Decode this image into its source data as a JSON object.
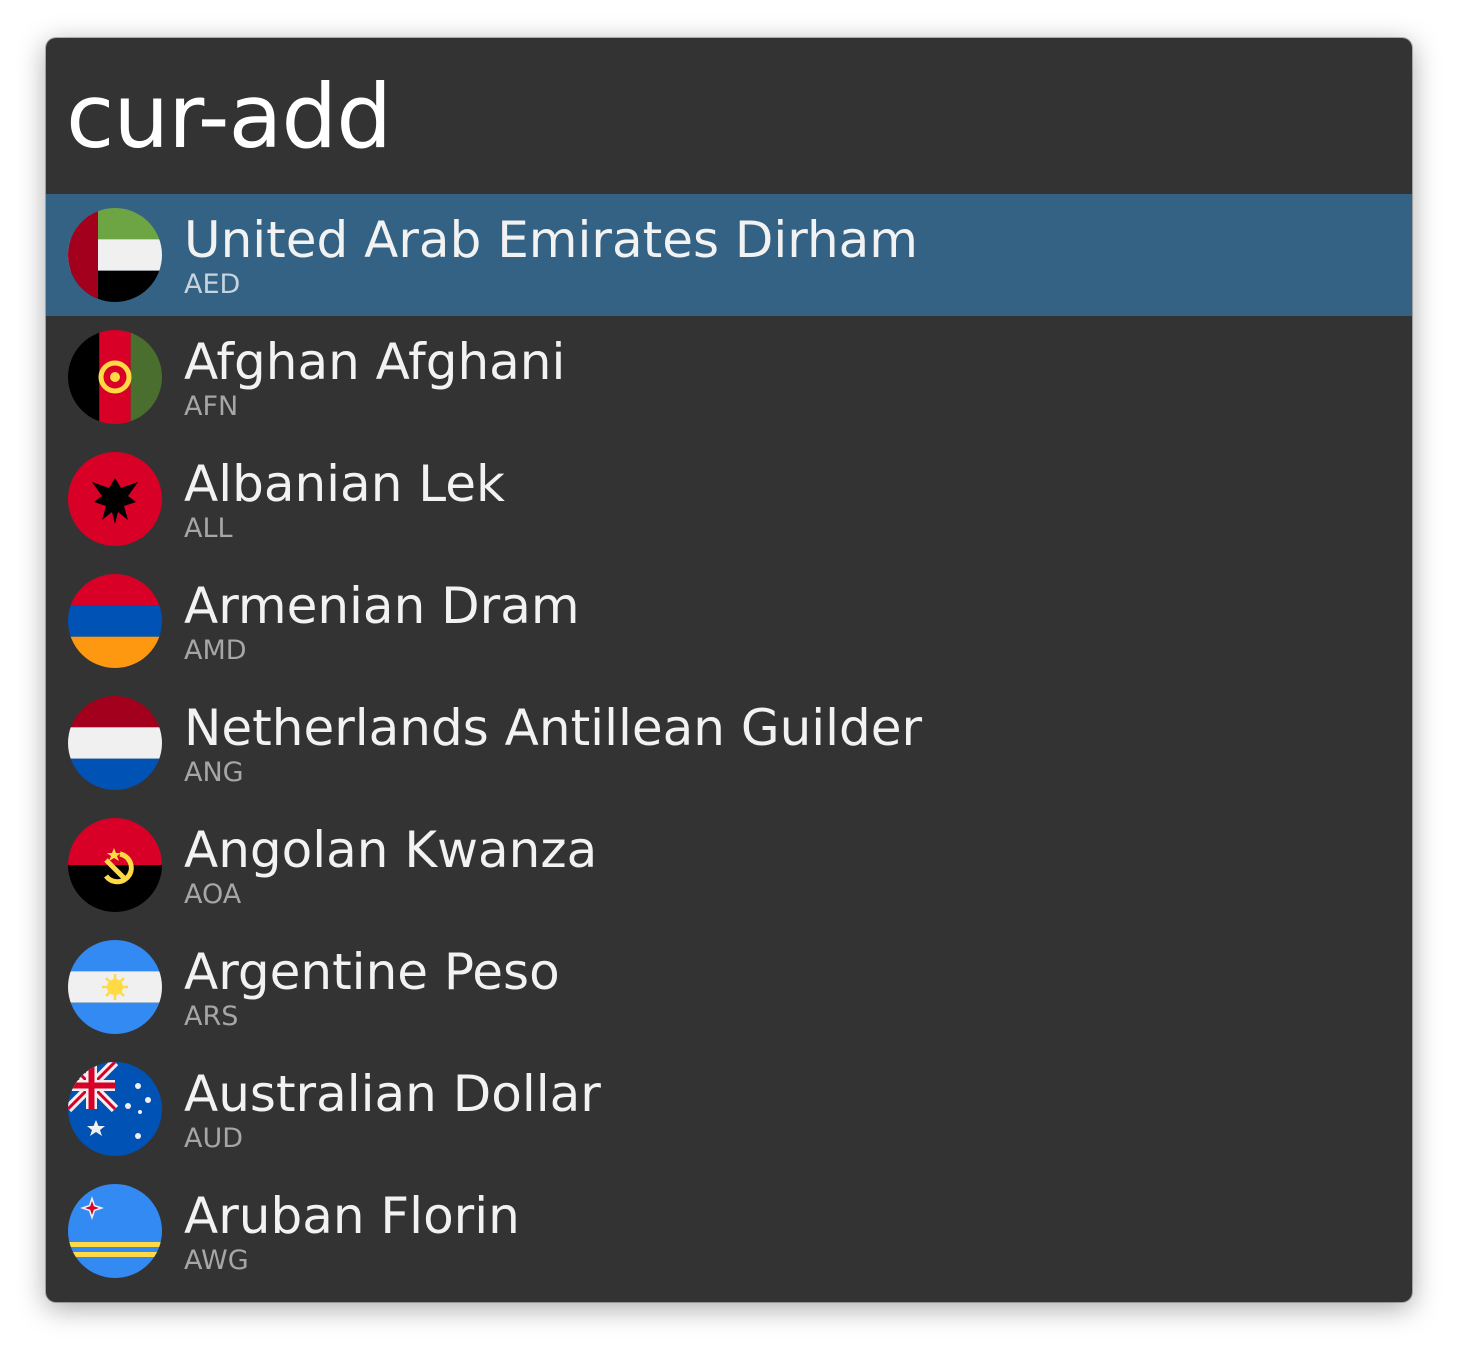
{
  "search": {
    "query": "cur-add"
  },
  "results": [
    {
      "name": "United Arab Emirates Dirham",
      "code": "AED",
      "flag_icon": "uae-flag-icon",
      "selected": true
    },
    {
      "name": "Afghan Afghani",
      "code": "AFN",
      "flag_icon": "afghanistan-flag-icon"
    },
    {
      "name": "Albanian Lek",
      "code": "ALL",
      "flag_icon": "albania-flag-icon"
    },
    {
      "name": "Armenian Dram",
      "code": "AMD",
      "flag_icon": "armenia-flag-icon"
    },
    {
      "name": "Netherlands Antillean Guilder",
      "code": "ANG",
      "flag_icon": "netherlands-flag-icon"
    },
    {
      "name": "Angolan Kwanza",
      "code": "AOA",
      "flag_icon": "angola-flag-icon"
    },
    {
      "name": "Argentine Peso",
      "code": "ARS",
      "flag_icon": "argentina-flag-icon"
    },
    {
      "name": "Australian Dollar",
      "code": "AUD",
      "flag_icon": "australia-flag-icon"
    },
    {
      "name": "Aruban Florin",
      "code": "AWG",
      "flag_icon": "aruba-flag-icon"
    }
  ],
  "colors": {
    "window_bg": "#333333",
    "selection": "#336284",
    "title_text": "#f2f2f2",
    "code_text": "#a6a6a6"
  }
}
